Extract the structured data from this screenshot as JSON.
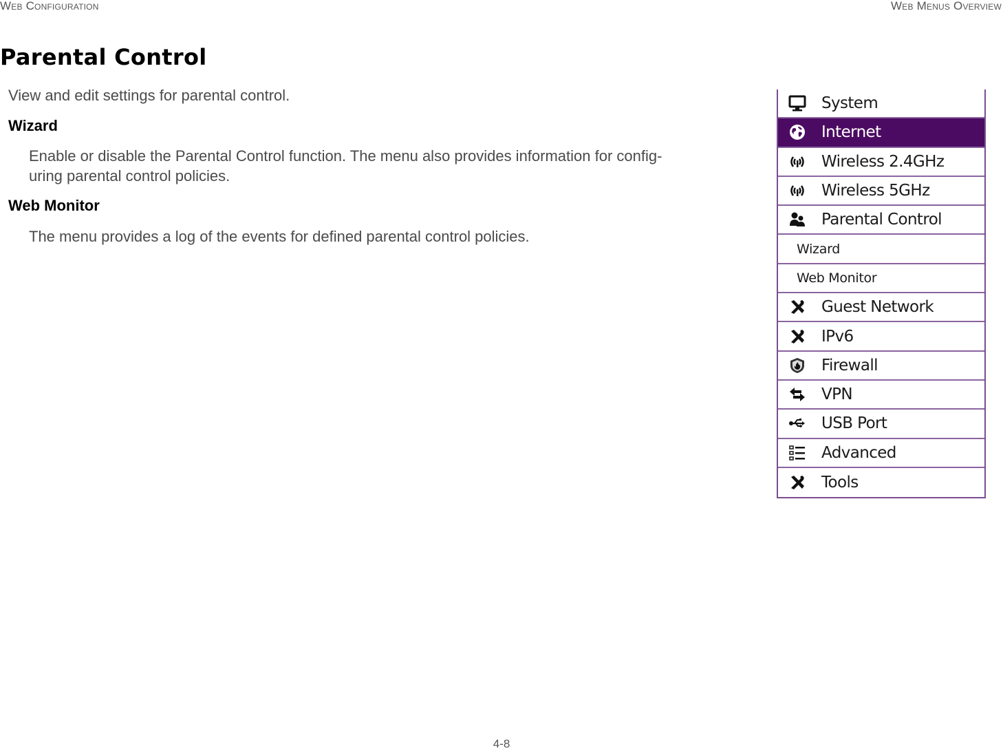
{
  "header": {
    "left": "Web Configuration",
    "right": "Web Menus Overview"
  },
  "page": {
    "title": "Parental Control",
    "intro": "View and edit settings for parental control.",
    "sections": [
      {
        "term": "Wizard",
        "description": "Enable or disable the Parental Control function. The menu also provides information for configuring parental control policies."
      },
      {
        "term": "Web Monitor",
        "description": "The menu provides a log of the events for defined parental control policies."
      }
    ]
  },
  "menu": {
    "accent_color": "#4b0b62",
    "border_color": "#7b4c92",
    "items": [
      {
        "label": "System",
        "icon": "monitor-icon",
        "active": false,
        "sub": false
      },
      {
        "label": "Internet",
        "icon": "globe-icon",
        "active": true,
        "sub": false
      },
      {
        "label": "Wireless 2.4GHz",
        "icon": "wireless-icon",
        "active": false,
        "sub": false
      },
      {
        "label": "Wireless 5GHz",
        "icon": "wireless-icon",
        "active": false,
        "sub": false
      },
      {
        "label": "Parental Control",
        "icon": "users-icon",
        "active": false,
        "sub": false
      },
      {
        "label": "Wizard",
        "icon": null,
        "active": false,
        "sub": true
      },
      {
        "label": "Web Monitor",
        "icon": null,
        "active": false,
        "sub": true
      },
      {
        "label": "Guest Network",
        "icon": "tools-icon",
        "active": false,
        "sub": false
      },
      {
        "label": "IPv6",
        "icon": "tools-icon",
        "active": false,
        "sub": false
      },
      {
        "label": "Firewall",
        "icon": "shield-fire-icon",
        "active": false,
        "sub": false
      },
      {
        "label": "VPN",
        "icon": "exchange-arrows-icon",
        "active": false,
        "sub": false
      },
      {
        "label": "USB Port",
        "icon": "usb-icon",
        "active": false,
        "sub": false
      },
      {
        "label": "Advanced",
        "icon": "list-icon",
        "active": false,
        "sub": false
      },
      {
        "label": "Tools",
        "icon": "tools-icon",
        "active": false,
        "sub": false
      }
    ]
  },
  "footer": {
    "page_number": "4-8"
  }
}
